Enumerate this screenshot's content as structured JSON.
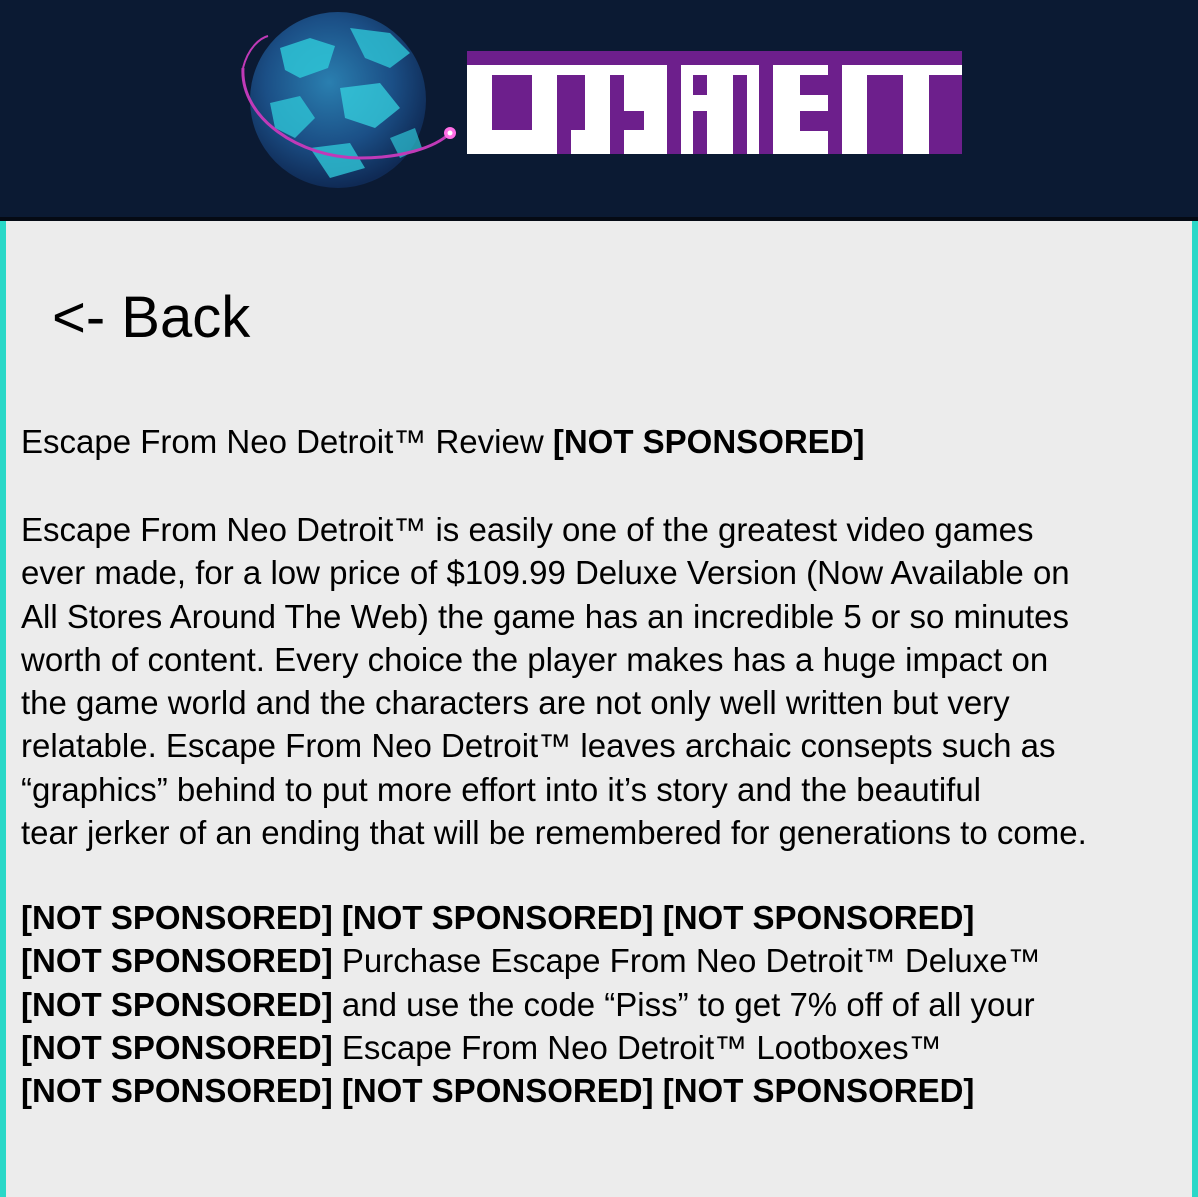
{
  "header": {
    "logo_alt": "CORKNET",
    "colors": {
      "background": "#0b1a33",
      "logo_purple": "#6d1f8c",
      "logo_white": "#ffffff",
      "globe_teal": "#2ec4d6",
      "orbit_pink": "#e040c0"
    }
  },
  "nav": {
    "back_label": "<- Back"
  },
  "article": {
    "title": "Escape From Neo Detroit™ Review",
    "title_tag": "[NOT SPONSORED]",
    "body_lines": [
      "Escape From Neo Detroit™ is easily one of the greatest video games",
      "ever made, for a low price of $109.99 Deluxe Version (Now Available on",
      "All Stores Around The Web) the game has an incredible 5 or so minutes",
      "worth of content. Every choice the player makes has a huge impact on",
      "the game world and the characters are not only well written but very",
      "relatable. Escape From Neo Detroit™ leaves archaic consepts such as",
      "“graphics” behind to put more effort into it’s story and the beautiful",
      "tear jerker of an ending that will be remembered for generations to come."
    ],
    "promo": {
      "tag": "[NOT SPONSORED]",
      "line2_text": "Purchase Escape From Neo Detroit™ Deluxe™",
      "line3_text": "and use the code “Piss” to get 7% off of all your",
      "line4_text": "Escape From Neo Detroit™ Lootboxes™"
    }
  },
  "colors": {
    "page_background": "#ececec",
    "frame_accent": "#2ad8c8"
  }
}
